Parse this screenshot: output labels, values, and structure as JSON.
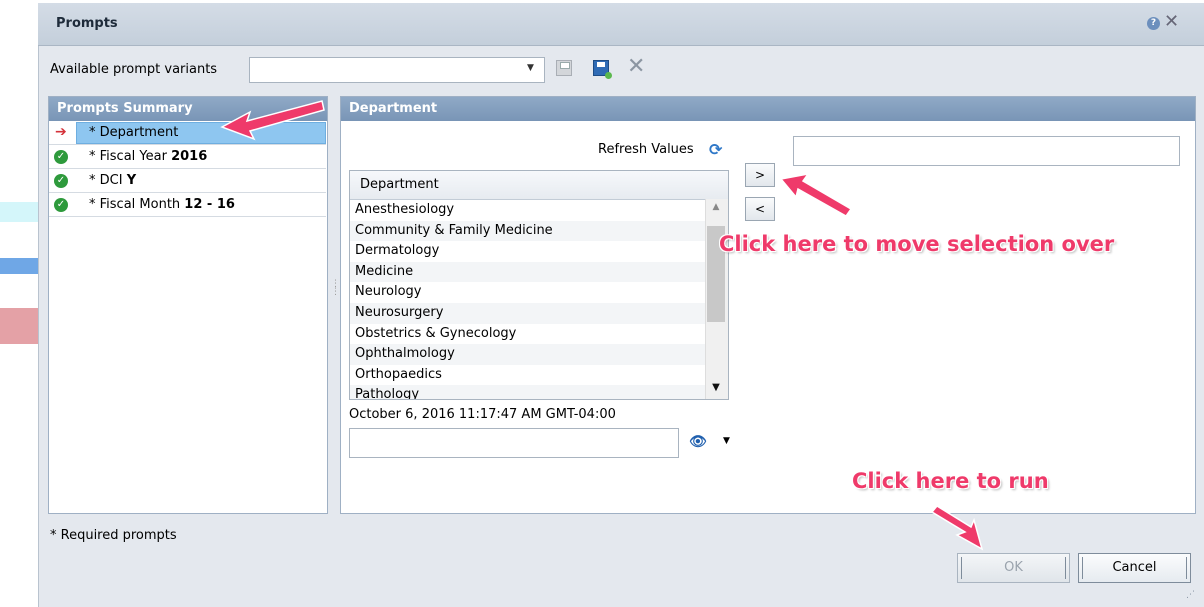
{
  "dialog": {
    "title": "Prompts",
    "help_icon": "?",
    "close_icon": "✕"
  },
  "variants": {
    "label": "Available prompt variants",
    "value": "",
    "icons": [
      "save-icon",
      "save-as-icon",
      "delete-icon"
    ]
  },
  "summary": {
    "header": "Prompts Summary",
    "items": [
      {
        "label": "* Department",
        "value": "",
        "status": "current"
      },
      {
        "label": "* Fiscal Year ",
        "value": "2016",
        "status": "ok"
      },
      {
        "label": "* DCI ",
        "value": "Y",
        "status": "ok"
      },
      {
        "label": "* Fiscal Month ",
        "value": "12 - 16",
        "status": "ok"
      }
    ]
  },
  "department": {
    "header": "Department",
    "refresh_label": "Refresh Values",
    "list_header": "Department",
    "items": [
      "Anesthesiology",
      "Community & Family Medicine",
      "Dermatology",
      "Medicine",
      "Neurology",
      "Neurosurgery",
      "Obstetrics & Gynecology",
      "Ophthalmology",
      "Orthopaedics",
      "Pathology"
    ],
    "move_right": ">",
    "move_left": "<",
    "selected_value": "",
    "timestamp": "October 6, 2016 11:17:47 AM GMT-04:00",
    "search_value": ""
  },
  "annotations": {
    "move": "Click here to move selection over",
    "run": "Click here to run"
  },
  "footer": {
    "required_note": "* Required prompts",
    "ok_label": "OK",
    "cancel_label": "Cancel"
  },
  "colors": {
    "annotation": "#ef3a6a",
    "header_bg": "#7995b6",
    "selected_row": "#8ec6f0",
    "check_green": "#2e9a3c"
  }
}
